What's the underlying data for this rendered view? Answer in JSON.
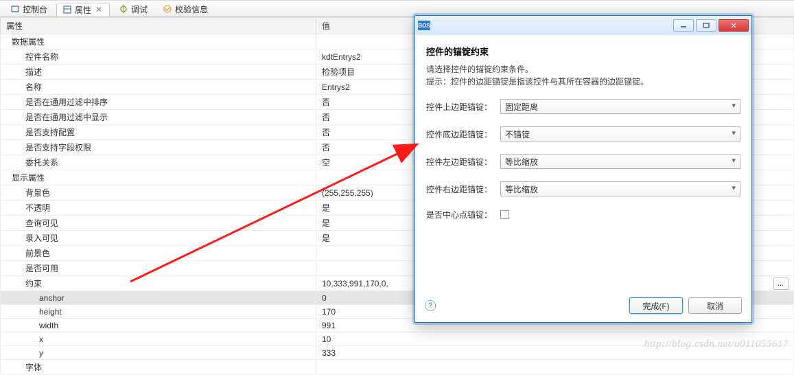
{
  "tabs": {
    "console": "控制台",
    "properties": "属性",
    "debug": "调试",
    "validate": "校验信息"
  },
  "table": {
    "head_prop": "属性",
    "head_val": "值",
    "rows": [
      {
        "indent": 0,
        "name": "数据属性",
        "val": ""
      },
      {
        "indent": 1,
        "name": "控件名称",
        "val": "kdtEntrys2"
      },
      {
        "indent": 1,
        "name": "描述",
        "val": "检验项目"
      },
      {
        "indent": 1,
        "name": "名称",
        "val": "Entrys2"
      },
      {
        "indent": 1,
        "name": "是否在通用过滤中排序",
        "val": "否"
      },
      {
        "indent": 1,
        "name": "是否在通用过滤中显示",
        "val": "否"
      },
      {
        "indent": 1,
        "name": "是否支持配置",
        "val": "否"
      },
      {
        "indent": 1,
        "name": "是否支持字段权限",
        "val": "否"
      },
      {
        "indent": 1,
        "name": "委托关系",
        "val": "空"
      },
      {
        "indent": 0,
        "name": "显示属性",
        "val": ""
      },
      {
        "indent": 1,
        "name": "背景色",
        "val": "(255,255,255)"
      },
      {
        "indent": 1,
        "name": "不透明",
        "val": "是"
      },
      {
        "indent": 1,
        "name": "查询可见",
        "val": "是"
      },
      {
        "indent": 1,
        "name": "录入可见",
        "val": "是"
      },
      {
        "indent": 1,
        "name": "前景色",
        "val": ""
      },
      {
        "indent": 1,
        "name": "是否可用",
        "val": ""
      },
      {
        "indent": 1,
        "name": "约束",
        "val": "10,333,991,170,0,"
      },
      {
        "indent": 2,
        "name": "anchor",
        "val": "0",
        "sel": true
      },
      {
        "indent": 2,
        "name": "height",
        "val": "170"
      },
      {
        "indent": 2,
        "name": "width",
        "val": "991"
      },
      {
        "indent": 2,
        "name": "x",
        "val": "10"
      },
      {
        "indent": 2,
        "name": "y",
        "val": "333"
      },
      {
        "indent": 1,
        "name": "字体",
        "val": ""
      }
    ]
  },
  "dialog": {
    "appicon": "BOS",
    "heading": "控件的锚锭约束",
    "desc1": "请选择控件的锚锭约束条件。",
    "desc2": "提示：控件的边距锚锭是指该控件与其所在容器的边距锚锭。",
    "fields": {
      "top": {
        "label": "控件上边距锚锭：",
        "value": "固定距离"
      },
      "bottom": {
        "label": "控件底边距锚锭：",
        "value": "不锚锭"
      },
      "left": {
        "label": "控件左边距锚锭：",
        "value": "等比缩放"
      },
      "right": {
        "label": "控件右边距锚锭：",
        "value": "等比缩放"
      },
      "center": {
        "label": "是否中心点锚锭：",
        "checked": false
      }
    },
    "buttons": {
      "finish": "完成(F)",
      "cancel": "取消"
    }
  },
  "watermark": "http://blog.csdn.net/u011055617"
}
